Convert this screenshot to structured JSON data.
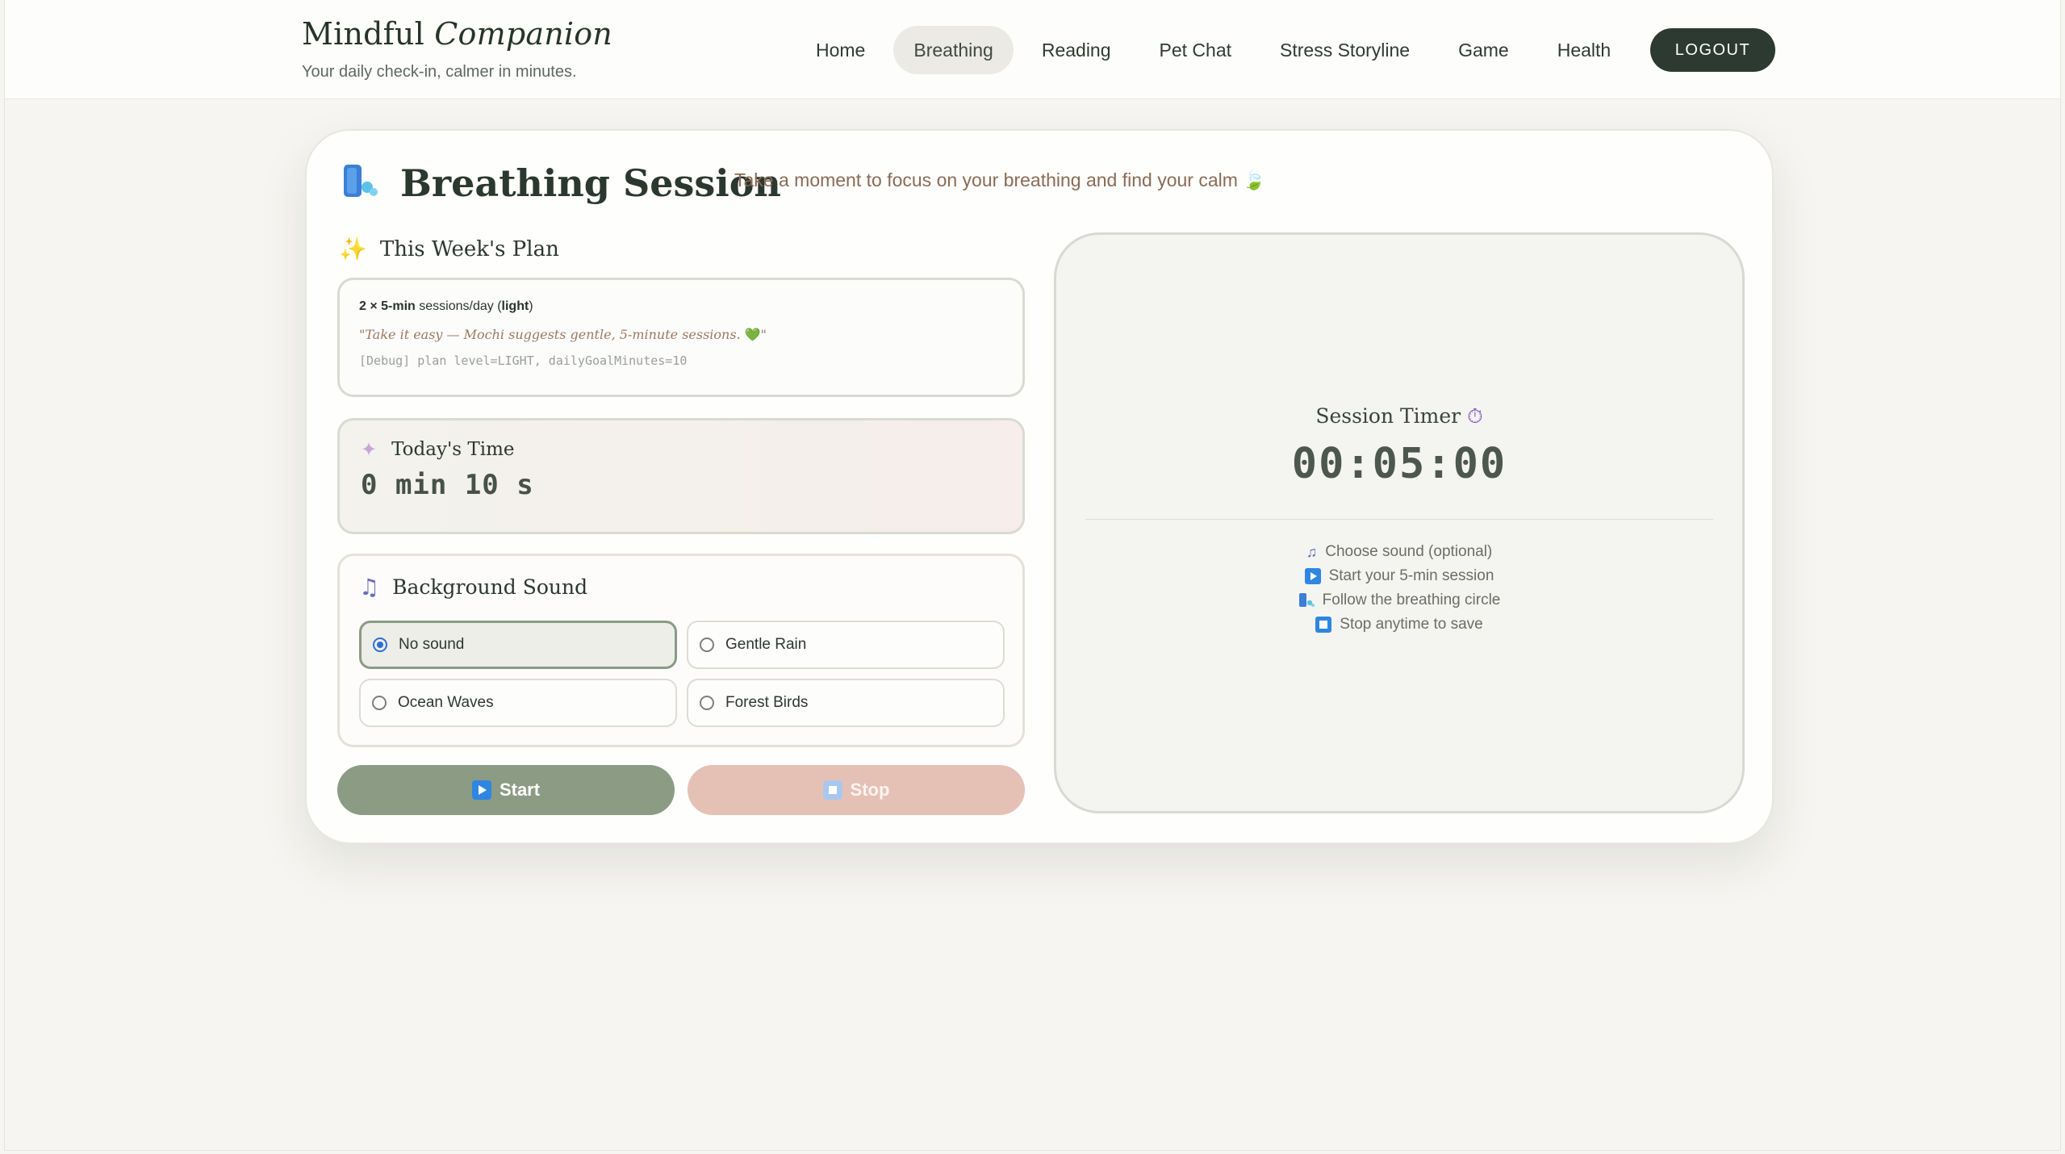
{
  "header": {
    "brand_main": "Mindful",
    "brand_italic": "Companion",
    "tagline": "Your daily check-in, calmer in minutes.",
    "nav": [
      {
        "label": "Home",
        "active": false
      },
      {
        "label": "Breathing",
        "active": true
      },
      {
        "label": "Reading",
        "active": false
      },
      {
        "label": "Pet Chat",
        "active": false
      },
      {
        "label": "Stress Storyline",
        "active": false
      },
      {
        "label": "Game",
        "active": false
      },
      {
        "label": "Health",
        "active": false
      }
    ],
    "logout_label": "LOGOUT"
  },
  "page": {
    "title": "Breathing Session",
    "subtitle": "Take a moment to focus on your breathing and find your calm",
    "subtitle_emoji": "🍃"
  },
  "plan": {
    "section_title": "This Week's Plan",
    "sessions_count": "2 × 5-min",
    "sessions_text": " sessions/day (",
    "level": "light",
    "sessions_close": ")",
    "quote": "\"Take it easy — Mochi suggests gentle, 5-minute sessions. ",
    "quote_emoji": "💚",
    "quote_end": "\"",
    "debug": "[Debug] plan level=LIGHT, dailyGoalMinutes=10"
  },
  "today": {
    "label": "Today's Time",
    "value": "0 min 10 s"
  },
  "sound": {
    "title": "Background Sound",
    "options": [
      {
        "label": "No sound",
        "selected": true
      },
      {
        "label": "Gentle Rain",
        "selected": false
      },
      {
        "label": "Ocean Waves",
        "selected": false
      },
      {
        "label": "Forest Birds",
        "selected": false
      }
    ]
  },
  "controls": {
    "start_label": "Start",
    "stop_label": "Stop"
  },
  "timer": {
    "label": "Session Timer",
    "value": "00:05:00",
    "steps": [
      {
        "icon": "music-icon",
        "text": "Choose sound (optional)"
      },
      {
        "icon": "play-icon",
        "text": "Start your 5-min session"
      },
      {
        "icon": "breathing-icon",
        "text": "Follow the breathing circle"
      },
      {
        "icon": "stop-icon",
        "text": "Stop anytime to save"
      }
    ]
  },
  "colors": {
    "accent": "#8b9b84",
    "stop": "#e5c1b5",
    "dark": "#2c3a31",
    "background": "#f6f5f1"
  }
}
